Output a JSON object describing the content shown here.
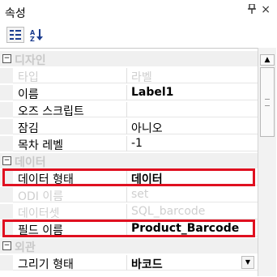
{
  "panel": {
    "title": "속성",
    "pin_glyph": "📌",
    "close_glyph": "×"
  },
  "toolbar": {
    "categorized_icon": "categorized-icon",
    "alphabetical_icon": "alphabetical-sort-icon",
    "alphabetical_glyph": "↓"
  },
  "grid": {
    "rows": [
      {
        "kind": "cat",
        "name": "디자인",
        "expanded": true
      },
      {
        "kind": "prop",
        "name": "타입",
        "value": "라벨",
        "faded": true,
        "bold": false
      },
      {
        "kind": "prop",
        "name": "이름",
        "value": "Label1",
        "faded": false,
        "bold": true
      },
      {
        "kind": "prop",
        "name": "오즈 스크립트",
        "value": "",
        "faded": false,
        "bold": false
      },
      {
        "kind": "prop",
        "name": "잠김",
        "value": "아니오",
        "faded": false,
        "bold": false
      },
      {
        "kind": "prop",
        "name": "목차 레벨",
        "value": "-1",
        "faded": false,
        "bold": false
      },
      {
        "kind": "cat",
        "name": "데이터",
        "expanded": true
      },
      {
        "kind": "prop",
        "name": "데이터 형태",
        "value": "데이터",
        "faded": false,
        "bold": true,
        "highlighted": true
      },
      {
        "kind": "prop",
        "name": "ODI 이름",
        "value": "set",
        "faded": true,
        "bold": false
      },
      {
        "kind": "prop",
        "name": "데이터셋",
        "value": "SQL_barcode",
        "faded": true,
        "bold": false
      },
      {
        "kind": "prop",
        "name": "필드 이름",
        "value": "Product_Barcode",
        "faded": false,
        "bold": true,
        "highlighted": true
      },
      {
        "kind": "cat",
        "name": "외관",
        "expanded": true
      },
      {
        "kind": "prop",
        "name": "그리기 형태",
        "value": "바코드",
        "faded": false,
        "bold": true,
        "dropdown": true
      }
    ]
  },
  "scrollbar": {
    "up_glyph": "▲"
  },
  "colors": {
    "highlight_border": "#e01020",
    "category_bg": "#f0f0f0",
    "faded_text": "#cfcfcf"
  }
}
